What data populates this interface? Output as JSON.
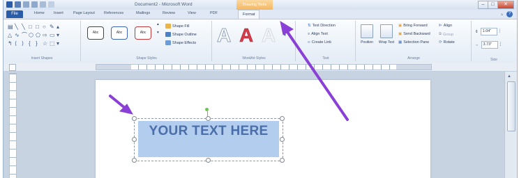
{
  "window": {
    "title": "Document2 - Microsoft Word",
    "context_tab": "Drawing Tools",
    "controls": [
      "minimize-icon",
      "maximize-icon",
      "close-icon"
    ]
  },
  "tabs": {
    "file": "File",
    "items": [
      "Home",
      "Insert",
      "Page Layout",
      "References",
      "Mailings",
      "Review",
      "View",
      "PDF"
    ],
    "active": "Format"
  },
  "ribbon": {
    "insert_shapes": {
      "label": "Insert Shapes",
      "icons": [
        "line-icon",
        "arrow-icon",
        "rectangle-icon",
        "oval-icon",
        "curve-icon",
        "star-icon"
      ]
    },
    "shape_styles": {
      "label": "Shape Styles",
      "presets": [
        "Abc",
        "Abc",
        "Abc"
      ],
      "fill": "Shape Fill",
      "outline": "Shape Outline",
      "effects": "Shape Effects"
    },
    "wordart_styles": {
      "label": "WordArt Styles",
      "glyph": "A",
      "colors": [
        "#b8c6d8",
        "#d43c4a",
        "#e8ecf2"
      ]
    },
    "text": {
      "label": "Text",
      "direction": "Text Direction",
      "align": "Align Text",
      "link": "Create Link"
    },
    "arrange": {
      "label": "Arrange",
      "position": "Position",
      "wrap": "Wrap Text",
      "bring_forward": "Bring Forward",
      "send_backward": "Send Backward",
      "selection_pane": "Selection Pane",
      "align": "Align",
      "group": "Group",
      "rotate": "Rotate"
    },
    "size": {
      "label": "Size",
      "height": "1.04\"",
      "width": "3.73\""
    }
  },
  "document": {
    "textbox_text": "YOUR TEXT HERE"
  },
  "annotations": {
    "arrow_color": "#8a3fd6",
    "count": 2
  }
}
